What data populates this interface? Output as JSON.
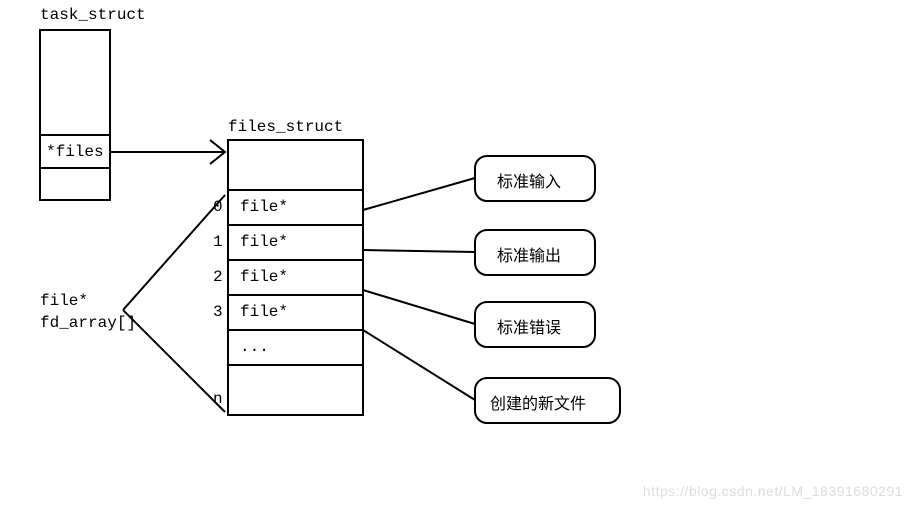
{
  "task_struct": {
    "title": "task_struct",
    "files_field": "*files"
  },
  "files_struct": {
    "title": "files_struct",
    "indices": [
      "0",
      "1",
      "2",
      "3",
      " ",
      "n"
    ],
    "rows": [
      "file*",
      "file*",
      "file*",
      "file*",
      "..."
    ]
  },
  "array_label_line1": "file*",
  "array_label_line2": "fd_array[]",
  "targets": {
    "stdin": "标准输入",
    "stdout": "标准输出",
    "stderr": "标准错误",
    "newfile": "创建的新文件"
  },
  "watermark": "https://blog.csdn.net/LM_18391680291"
}
